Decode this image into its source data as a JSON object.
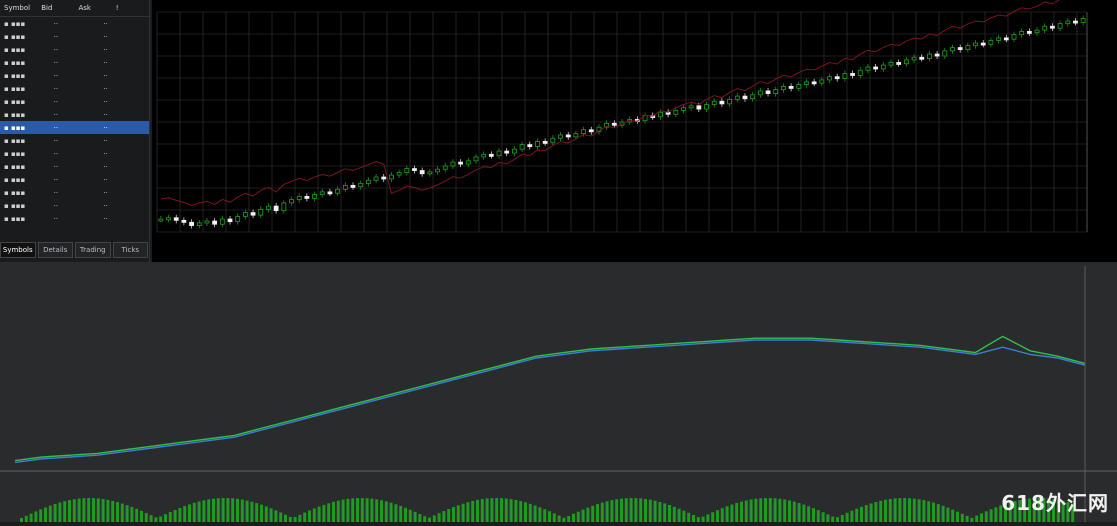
{
  "market_watch": {
    "headers": [
      "Symbol",
      "Bid",
      "Ask",
      "!"
    ],
    "rows": [
      {
        "c1": "▪ ▪▪▪",
        "c2": "··",
        "c3": "··"
      },
      {
        "c1": "▪ ▪▪▪",
        "c2": "··",
        "c3": "··"
      },
      {
        "c1": "▪ ▪▪▪",
        "c2": "··",
        "c3": "··"
      },
      {
        "c1": "▪ ▪▪▪",
        "c2": "··",
        "c3": "··"
      },
      {
        "c1": "▪ ▪▪▪",
        "c2": "··",
        "c3": "··"
      },
      {
        "c1": "▪ ▪▪▪",
        "c2": "··",
        "c3": "··"
      },
      {
        "c1": "▪ ▪▪▪",
        "c2": "··",
        "c3": "··"
      },
      {
        "c1": "▪ ▪▪▪",
        "c2": "··",
        "c3": "··"
      },
      {
        "c1": "▪ ▪▪▪",
        "c2": "··",
        "c3": "··"
      },
      {
        "c1": "▪ ▪▪▪",
        "c2": "··",
        "c3": "··"
      },
      {
        "c1": "▪ ▪▪▪",
        "c2": "··",
        "c3": "··"
      },
      {
        "c1": "▪ ▪▪▪",
        "c2": "··",
        "c3": "··"
      },
      {
        "c1": "▪ ▪▪▪",
        "c2": "··",
        "c3": "··"
      },
      {
        "c1": "▪ ▪▪▪",
        "c2": "··",
        "c3": "··"
      },
      {
        "c1": "▪ ▪▪▪",
        "c2": "··",
        "c3": "··"
      },
      {
        "c1": "▪ ▪▪▪",
        "c2": "··",
        "c3": "··"
      }
    ],
    "selected_index": 8,
    "tabs": [
      "Symbols",
      "Details",
      "Trading",
      "Ticks"
    ]
  },
  "brand_text": "618外汇网",
  "colors": {
    "grid": "#3a3a3a",
    "bull": "#1fa31f",
    "bear": "#f2f2f2",
    "ma_line": "#7a1620",
    "line_green": "#2ec04a",
    "line_blue": "#3b7fd6",
    "volume": "#1f9a22"
  },
  "chart_data": [
    {
      "type": "candlestick",
      "title": "",
      "close": [
        0.2,
        0.22,
        0.18,
        0.15,
        0.1,
        0.14,
        0.17,
        0.12,
        0.2,
        0.16,
        0.24,
        0.3,
        0.26,
        0.35,
        0.4,
        0.33,
        0.45,
        0.5,
        0.55,
        0.52,
        0.58,
        0.62,
        0.6,
        0.66,
        0.72,
        0.7,
        0.75,
        0.8,
        0.85,
        0.82,
        0.88,
        0.92,
        0.98,
        0.95,
        0.9,
        0.93,
        0.97,
        1.02,
        1.08,
        1.05,
        1.1,
        1.16,
        1.2,
        1.18,
        1.25,
        1.22,
        1.28,
        1.35,
        1.32,
        1.4,
        1.38,
        1.45,
        1.5,
        1.47,
        1.52,
        1.58,
        1.55,
        1.62,
        1.68,
        1.65,
        1.7,
        1.74,
        1.72,
        1.8,
        1.78,
        1.85,
        1.82,
        1.88,
        1.92,
        1.95,
        1.9,
        1.97,
        2.02,
        1.98,
        2.05,
        2.1,
        2.06,
        2.12,
        2.18,
        2.14,
        2.2,
        2.25,
        2.22,
        2.28,
        2.32,
        2.3,
        2.35,
        2.4,
        2.37,
        2.45,
        2.42,
        2.5,
        2.55,
        2.52,
        2.58,
        2.62,
        2.6,
        2.66,
        2.7,
        2.68,
        2.75,
        2.72,
        2.8,
        2.85,
        2.82,
        2.88,
        2.92,
        2.9,
        2.96,
        3.0,
        2.98,
        3.05,
        3.1,
        3.08,
        3.12,
        3.18,
        3.15,
        3.22,
        3.26,
        3.24,
        3.3
      ],
      "ma": "falling-then-rising"
    },
    {
      "type": "line",
      "series": [
        {
          "values": [
            0.02,
            0.04,
            0.05,
            0.06,
            0.08,
            0.1,
            0.12,
            0.14,
            0.16,
            0.2,
            0.24,
            0.28,
            0.32,
            0.36,
            0.4,
            0.44,
            0.48,
            0.52,
            0.56,
            0.6,
            0.62,
            0.64,
            0.65,
            0.66,
            0.67,
            0.68,
            0.69,
            0.7,
            0.7,
            0.7,
            0.69,
            0.68,
            0.67,
            0.66,
            0.64,
            0.62,
            0.66,
            0.62,
            0.6,
            0.56
          ]
        },
        {
          "values": [
            0.03,
            0.05,
            0.06,
            0.07,
            0.09,
            0.11,
            0.13,
            0.15,
            0.17,
            0.21,
            0.25,
            0.29,
            0.33,
            0.37,
            0.41,
            0.45,
            0.49,
            0.53,
            0.57,
            0.61,
            0.63,
            0.65,
            0.66,
            0.67,
            0.68,
            0.69,
            0.7,
            0.71,
            0.71,
            0.71,
            0.7,
            0.69,
            0.68,
            0.67,
            0.65,
            0.63,
            0.72,
            0.64,
            0.61,
            0.57
          ]
        }
      ],
      "ylim": [
        0,
        1
      ]
    }
  ]
}
